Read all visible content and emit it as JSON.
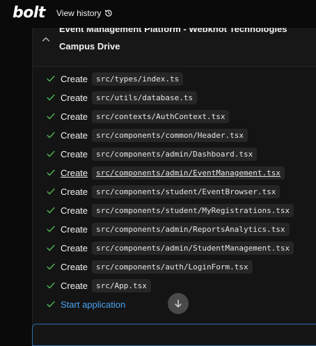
{
  "app": {
    "logo": "bolt",
    "view_history_label": "View history"
  },
  "panel": {
    "title_line1": "Event Management Platform - Webknot Technologies",
    "title_line2": "Campus Drive"
  },
  "actions": [
    {
      "verb": "Create",
      "path": "src/types/index.ts"
    },
    {
      "verb": "Create",
      "path": "src/utils/database.ts"
    },
    {
      "verb": "Create",
      "path": "src/contexts/AuthContext.tsx"
    },
    {
      "verb": "Create",
      "path": "src/components/common/Header.tsx"
    },
    {
      "verb": "Create",
      "path": "src/components/admin/Dashboard.tsx"
    },
    {
      "verb": "Create",
      "path": "src/components/admin/EventManagement.tsx"
    },
    {
      "verb": "Create",
      "path": "src/components/student/EventBrowser.tsx"
    },
    {
      "verb": "Create",
      "path": "src/components/student/MyRegistrations.tsx"
    },
    {
      "verb": "Create",
      "path": "src/components/admin/ReportsAnalytics.tsx"
    },
    {
      "verb": "Create",
      "path": "src/components/admin/StudentManagement.tsx"
    },
    {
      "verb": "Create",
      "path": "src/components/auth/LoginForm.tsx"
    },
    {
      "verb": "Create",
      "path": "src/App.tsx"
    }
  ],
  "start_action": {
    "label": "Start application"
  },
  "colors": {
    "check": "#4caf50",
    "link": "#4aa3f0",
    "accent_border": "#2e6fb6"
  }
}
